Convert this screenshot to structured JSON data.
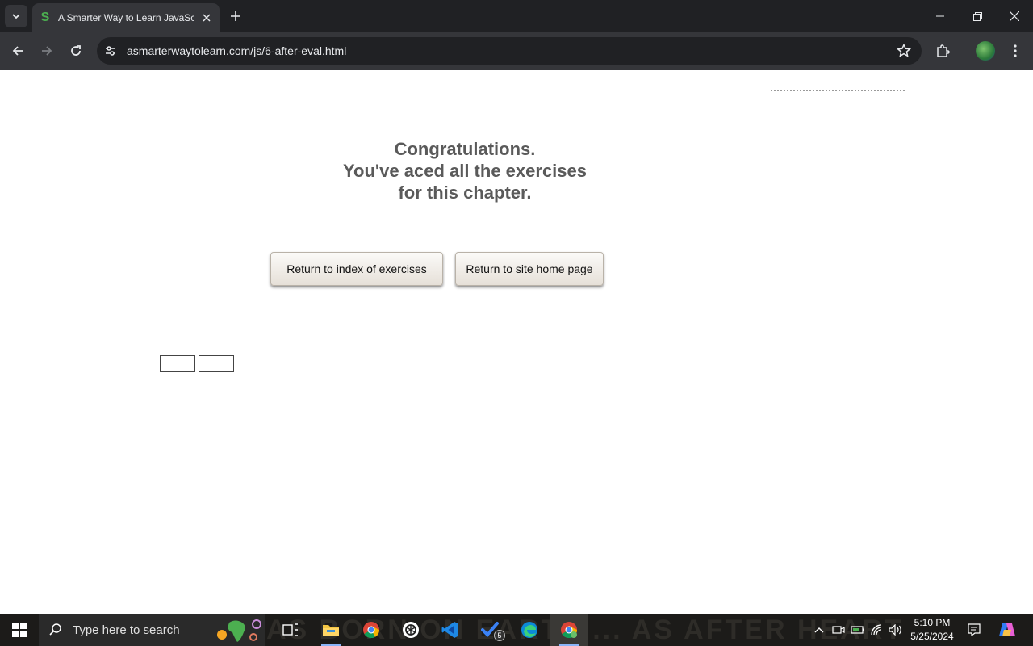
{
  "browser": {
    "tab_title": "A Smarter Way to Learn JavaScript",
    "url": "asmarterwaytolearn.com/js/6-after-eval.html"
  },
  "page": {
    "congrats_line1": "Congratulations.",
    "congrats_line2": "You've aced all the exercises",
    "congrats_line3": "for this chapter.",
    "button_index": "Return to index of exercises",
    "button_home": "Return to site home page"
  },
  "taskbar": {
    "search_placeholder": "Type here to search",
    "background_text": "AS BORN ON EARTH ... AS AFTER HEART TO ... HERE",
    "todo_badge": "5",
    "time": "5:10 PM",
    "date": "5/25/2024"
  },
  "colors": {
    "heading": "#5a5a5a",
    "chrome_dark": "#202124",
    "chrome_toolbar": "#35363a",
    "taskbar": "#1c1b19"
  }
}
